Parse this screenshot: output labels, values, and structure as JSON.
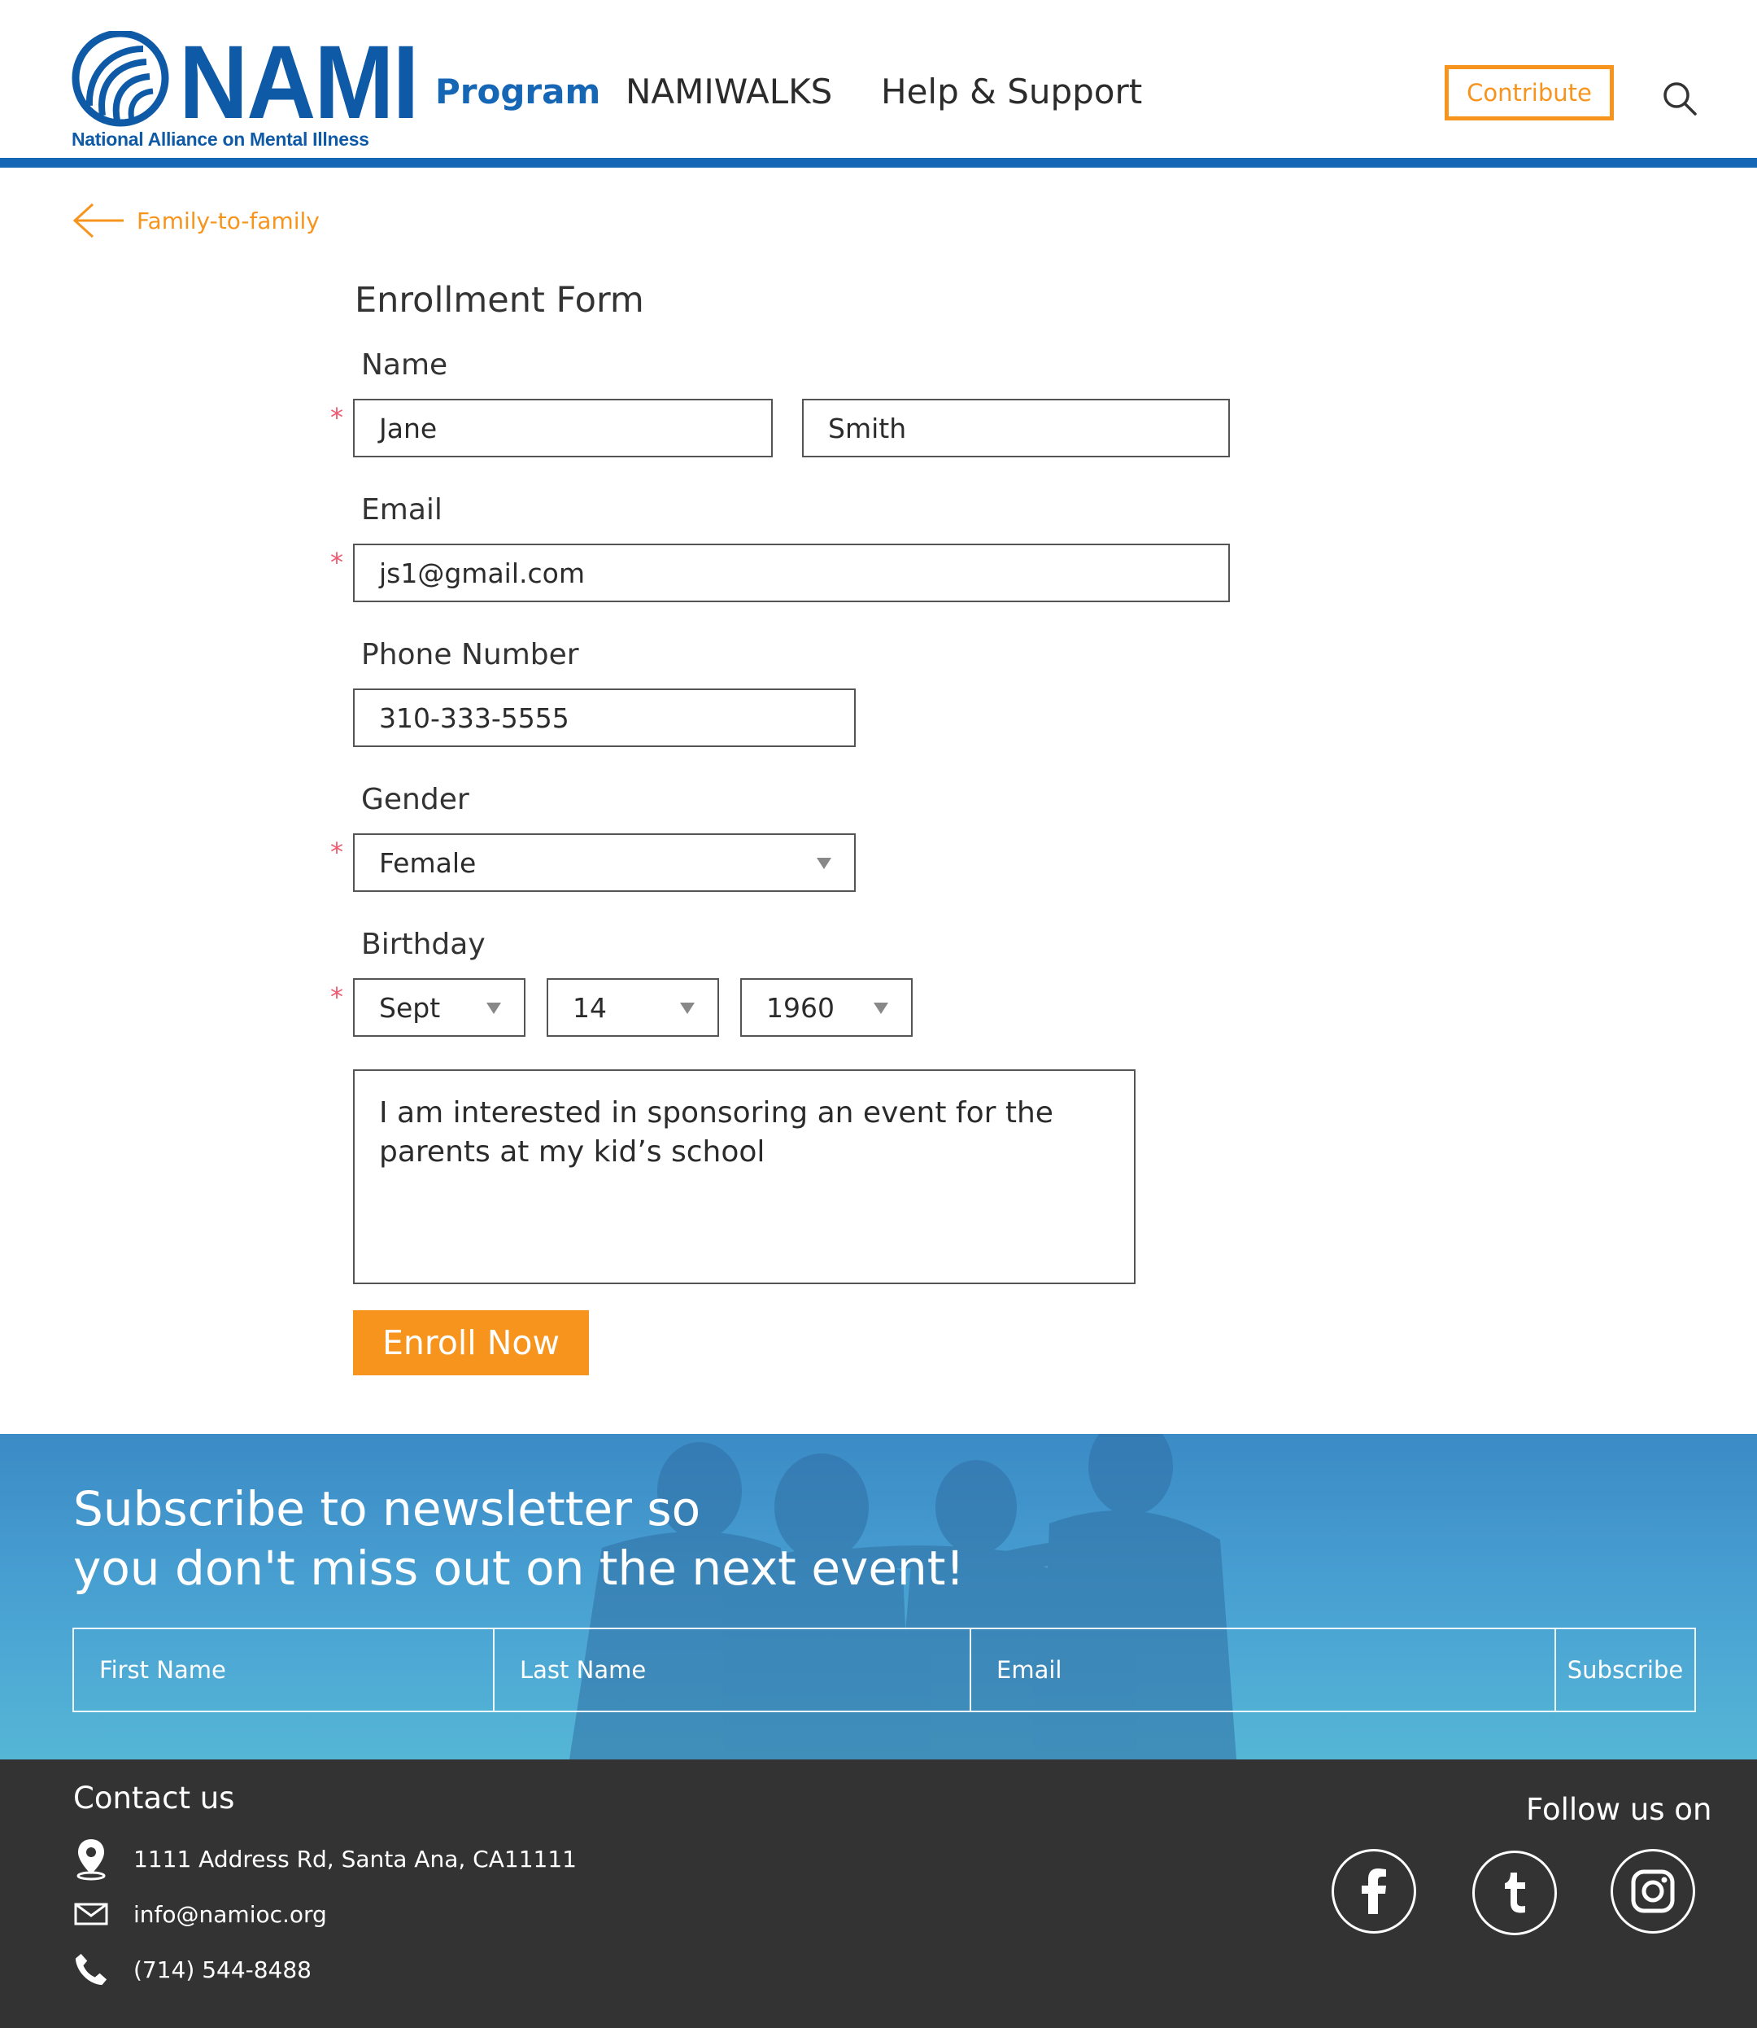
{
  "header": {
    "logo_wordmark": "NAMI",
    "logo_tagline": "National Alliance on Mental Illness",
    "nav": [
      "Program",
      "NAMIWALKS",
      "Help & Support"
    ],
    "contribute_label": "Contribute"
  },
  "back_link": {
    "label": "Family-to-family"
  },
  "form": {
    "title": "Enrollment Form",
    "required_mark": "*",
    "name_label": "Name",
    "first_name_value": "Jane",
    "last_name_value": "Smith",
    "email_label": "Email",
    "email_value": "js1@gmail.com",
    "phone_label": "Phone Number",
    "phone_value": "310-333-5555",
    "gender_label": "Gender",
    "gender_value": "Female",
    "birthday_label": "Birthday",
    "birth_month": "Sept",
    "birth_day": "14",
    "birth_year": "1960",
    "message_value": "I am interested in sponsoring an event for the parents at my kid’s school",
    "submit_label": "Enroll Now"
  },
  "newsletter": {
    "heading_line1": "Subscribe to newsletter so",
    "heading_line2": "you don't miss out on the next event!",
    "first_name_placeholder": "First Name",
    "last_name_placeholder": "Last Name",
    "email_placeholder": "Email",
    "subscribe_label": "Subscribe"
  },
  "footer": {
    "contact_title": "Contact us",
    "address": "1111 Address Rd, Santa Ana, CA11111",
    "email": "info@namioc.org",
    "phone": "(714) 544-8488",
    "follow_title": "Follow us on",
    "social": [
      "facebook-icon",
      "tumblr-icon",
      "instagram-icon"
    ]
  },
  "colors": {
    "brand_blue": "#1566b5",
    "accent_orange": "#f7941d",
    "required_red": "#ef5a6f",
    "footer_bg": "#333333"
  }
}
